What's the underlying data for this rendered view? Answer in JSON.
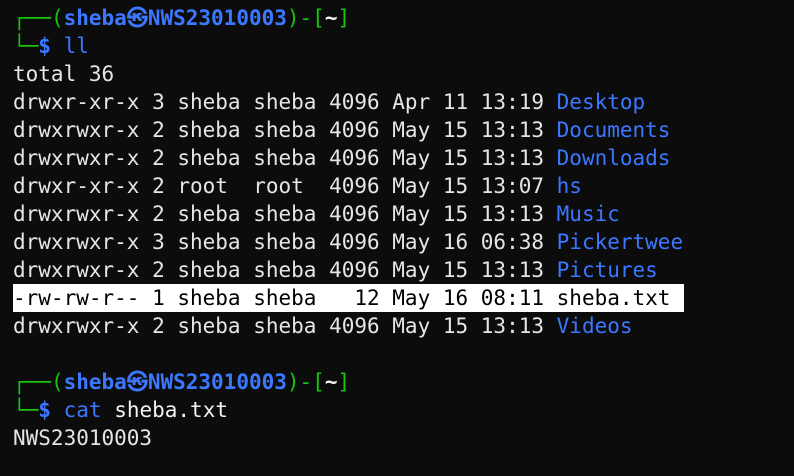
{
  "terminal": {
    "prompt1": {
      "corner_top": "┌──",
      "open": "(",
      "user": "sheba",
      "sep": "㉿",
      "host": "NWS23010003",
      "close": ")-[",
      "cwd": "~",
      "close2": "]",
      "corner_bottom": "└─",
      "dollar": "$",
      "command": "ll",
      "args": ""
    },
    "total": "total 36",
    "rows": [
      {
        "perms": "drwxr-xr-x",
        "links": "3",
        "owner": "sheba",
        "group": "sheba",
        "size": "4096",
        "month": "Apr",
        "day": "11",
        "time": "13:19",
        "name": "Desktop",
        "kind": "dir"
      },
      {
        "perms": "drwxrwxr-x",
        "links": "2",
        "owner": "sheba",
        "group": "sheba",
        "size": "4096",
        "month": "May",
        "day": "15",
        "time": "13:13",
        "name": "Documents",
        "kind": "dir"
      },
      {
        "perms": "drwxrwxr-x",
        "links": "2",
        "owner": "sheba",
        "group": "sheba",
        "size": "4096",
        "month": "May",
        "day": "15",
        "time": "13:13",
        "name": "Downloads",
        "kind": "dir"
      },
      {
        "perms": "drwxr-xr-x",
        "links": "2",
        "owner": "root",
        "group": "root",
        "size": "4096",
        "month": "May",
        "day": "15",
        "time": "13:07",
        "name": "hs",
        "kind": "dir"
      },
      {
        "perms": "drwxrwxr-x",
        "links": "2",
        "owner": "sheba",
        "group": "sheba",
        "size": "4096",
        "month": "May",
        "day": "15",
        "time": "13:13",
        "name": "Music",
        "kind": "dir"
      },
      {
        "perms": "drwxrwxr-x",
        "links": "3",
        "owner": "sheba",
        "group": "sheba",
        "size": "4096",
        "month": "May",
        "day": "16",
        "time": "06:38",
        "name": "Pickertwee",
        "kind": "dir"
      },
      {
        "perms": "drwxrwxr-x",
        "links": "2",
        "owner": "sheba",
        "group": "sheba",
        "size": "4096",
        "month": "May",
        "day": "15",
        "time": "13:13",
        "name": "Pictures",
        "kind": "dir"
      },
      {
        "perms": "-rw-rw-r--",
        "links": "1",
        "owner": "sheba",
        "group": "sheba",
        "size": "12",
        "month": "May",
        "day": "16",
        "time": "08:11",
        "name": "sheba.txt",
        "kind": "file-selected"
      },
      {
        "perms": "drwxrwxr-x",
        "links": "2",
        "owner": "sheba",
        "group": "sheba",
        "size": "4096",
        "month": "May",
        "day": "15",
        "time": "13:13",
        "name": "Videos",
        "kind": "dir"
      }
    ],
    "prompt2": {
      "corner_top": "┌──",
      "open": "(",
      "user": "sheba",
      "sep": "㉿",
      "host": "NWS23010003",
      "close": ")-[",
      "cwd": "~",
      "close2": "]",
      "corner_bottom": "└─",
      "dollar": "$",
      "command": "cat",
      "args": "sheba.txt"
    },
    "output": "NWS23010003",
    "colors": {
      "background": "#0c0c0c",
      "prompt_green": "#16c60c",
      "blue": "#3b78ff",
      "text": "#e6e6e6",
      "highlight_bg": "#ffffff"
    }
  }
}
